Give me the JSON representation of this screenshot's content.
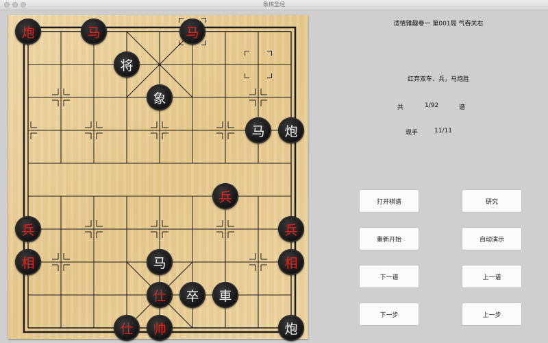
{
  "window": {
    "title": "象棋圣经"
  },
  "game": {
    "collection_title": "适情雅趣卷一 第001局 气吞关右",
    "description": "红弃双车、兵，马炮胜",
    "total_label": "共",
    "total_value": "1/92",
    "total_unit": "谱",
    "current_label": "现手",
    "current_value": "11/11"
  },
  "buttons": {
    "open": "打开棋谱",
    "research": "研究",
    "restart": "重新开始",
    "auto_play": "自动演示",
    "next_record": "下一谱",
    "prev_record": "上一谱",
    "next_step": "下一步",
    "prev_step": "上一步"
  },
  "board": {
    "pieces": [
      {
        "label": "炮",
        "side": "red",
        "col": 0,
        "row": 0
      },
      {
        "label": "马",
        "side": "red",
        "col": 2,
        "row": 0
      },
      {
        "label": "马",
        "side": "red",
        "col": 5,
        "row": 0
      },
      {
        "label": "将",
        "side": "black",
        "col": 3,
        "row": 1
      },
      {
        "label": "象",
        "side": "black",
        "col": 4,
        "row": 2
      },
      {
        "label": "马",
        "side": "black",
        "col": 7,
        "row": 3
      },
      {
        "label": "炮",
        "side": "black",
        "col": 8,
        "row": 3
      },
      {
        "label": "兵",
        "side": "red",
        "col": 6,
        "row": 5
      },
      {
        "label": "兵",
        "side": "red",
        "col": 0,
        "row": 6
      },
      {
        "label": "兵",
        "side": "red",
        "col": 8,
        "row": 6
      },
      {
        "label": "相",
        "side": "red",
        "col": 0,
        "row": 7
      },
      {
        "label": "马",
        "side": "black",
        "col": 4,
        "row": 7
      },
      {
        "label": "相",
        "side": "red",
        "col": 8,
        "row": 7
      },
      {
        "label": "仕",
        "side": "red",
        "col": 4,
        "row": 8
      },
      {
        "label": "卒",
        "side": "black",
        "col": 5,
        "row": 8
      },
      {
        "label": "車",
        "side": "black",
        "col": 6,
        "row": 8
      },
      {
        "label": "仕",
        "side": "red",
        "col": 3,
        "row": 9
      },
      {
        "label": "帅",
        "side": "red",
        "col": 4,
        "row": 9
      },
      {
        "label": "炮",
        "side": "black",
        "col": 8,
        "row": 9
      }
    ],
    "selection_markers": [
      {
        "col": 5,
        "row": 0
      },
      {
        "col": 7,
        "row": 1
      }
    ]
  }
}
